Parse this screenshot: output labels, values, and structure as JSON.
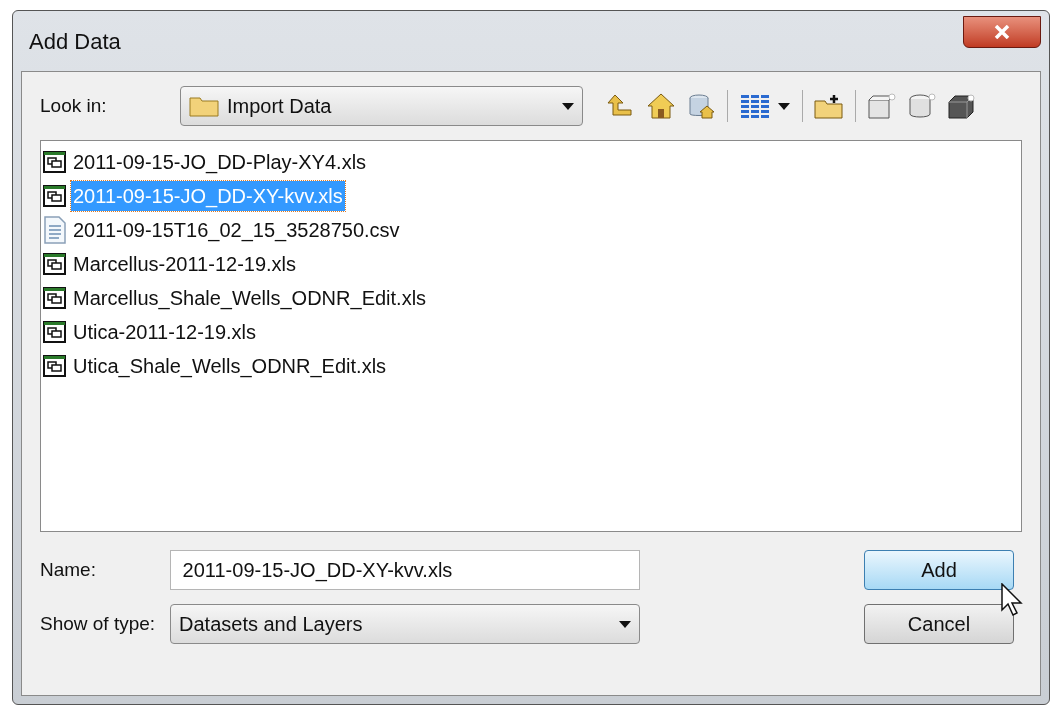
{
  "window": {
    "title": "Add Data"
  },
  "look_in": {
    "label": "Look in:",
    "value": "Import Data"
  },
  "files": [
    {
      "name": "2011-09-15-JO_DD-Play-XY4.xls",
      "kind": "table",
      "selected": false
    },
    {
      "name": "2011-09-15-JO_DD-XY-kvv.xls",
      "kind": "table",
      "selected": true
    },
    {
      "name": "2011-09-15T16_02_15_3528750.csv",
      "kind": "text",
      "selected": false
    },
    {
      "name": "Marcellus-2011-12-19.xls",
      "kind": "table",
      "selected": false
    },
    {
      "name": "Marcellus_Shale_Wells_ODNR_Edit.xls",
      "kind": "table",
      "selected": false
    },
    {
      "name": "Utica-2011-12-19.xls",
      "kind": "table",
      "selected": false
    },
    {
      "name": "Utica_Shale_Wells_ODNR_Edit.xls",
      "kind": "table",
      "selected": false
    }
  ],
  "name_field": {
    "label": "Name:",
    "value": "2011-09-15-JO_DD-XY-kvv.xls"
  },
  "type_field": {
    "label": "Show of type:",
    "value": "Datasets and Layers"
  },
  "buttons": [
    {
      "label": "Add",
      "highlighted": true
    },
    {
      "label": "Cancel",
      "highlighted": false
    }
  ]
}
